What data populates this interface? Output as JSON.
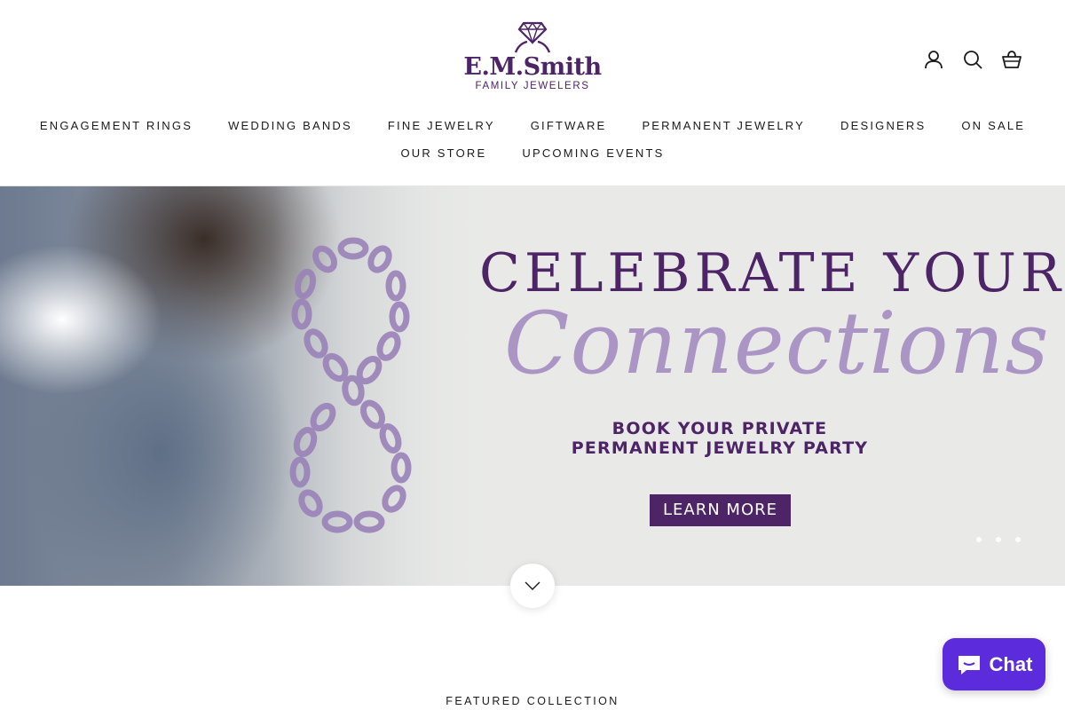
{
  "header": {
    "logo": {
      "name": "E.M.Smith",
      "subtitle": "FAMILY JEWELERS",
      "icon": "diamond-ring-icon",
      "color": "#4d2466"
    },
    "icons": [
      {
        "name": "account-icon"
      },
      {
        "name": "search-icon"
      },
      {
        "name": "cart-icon"
      }
    ]
  },
  "nav": {
    "row1": [
      "ENGAGEMENT RINGS",
      "WEDDING BANDS",
      "FINE JEWELRY",
      "GIFTWARE",
      "PERMANENT JEWELRY",
      "DESIGNERS",
      "ON SALE"
    ],
    "row2": [
      "OUR STORE",
      "UPCOMING EVENTS"
    ]
  },
  "hero": {
    "title": "CELEBRATE YOUR",
    "script": "Connections",
    "subtitle_line1": "BOOK YOUR PRIVATE",
    "subtitle_line2": "PERMANENT JEWELRY PARTY",
    "button_label": "LEARN MORE",
    "accent": "#4d2466",
    "script_color": "#a58cc2",
    "slide_count": 3
  },
  "featured_heading": "FEATURED COLLECTION",
  "chat": {
    "label": "Chat",
    "icon": "chat-bubble-icon",
    "color": "#5b2bdc"
  }
}
